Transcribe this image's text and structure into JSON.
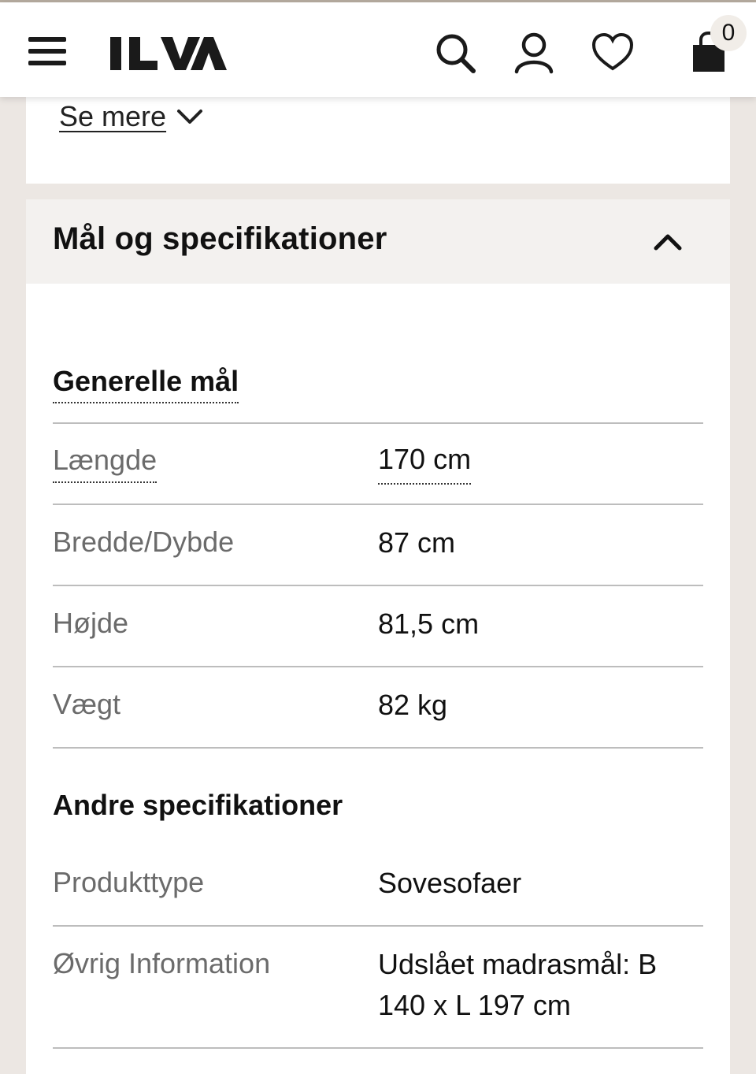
{
  "header": {
    "logo": "ILVA",
    "cart_count": "0",
    "icons": [
      "menu-icon",
      "search-icon",
      "account-icon",
      "heart-icon",
      "bag-icon"
    ]
  },
  "description": {
    "see_more_label": "Se mere"
  },
  "specs": {
    "title": "Mål og specifikationer",
    "general": {
      "title": "Generelle mål",
      "rows": [
        {
          "label": "Længde",
          "value": "170 cm"
        },
        {
          "label": "Bredde/Dybde",
          "value": "87 cm"
        },
        {
          "label": "Højde",
          "value": "81,5 cm"
        },
        {
          "label": "Vægt",
          "value": "82 kg"
        }
      ]
    },
    "other": {
      "title": "Andre specifikationer",
      "rows": [
        {
          "label": "Produkttype",
          "value": "Sovesofaer"
        },
        {
          "label": "Øvrig Information",
          "value": "Udslået madrasmål: B 140 x L 197 cm"
        }
      ]
    }
  },
  "colors": {
    "background": "#ece7e3",
    "panel_header": "#f3f1ef",
    "text": "#111111",
    "label_text": "#6b6b6b"
  }
}
